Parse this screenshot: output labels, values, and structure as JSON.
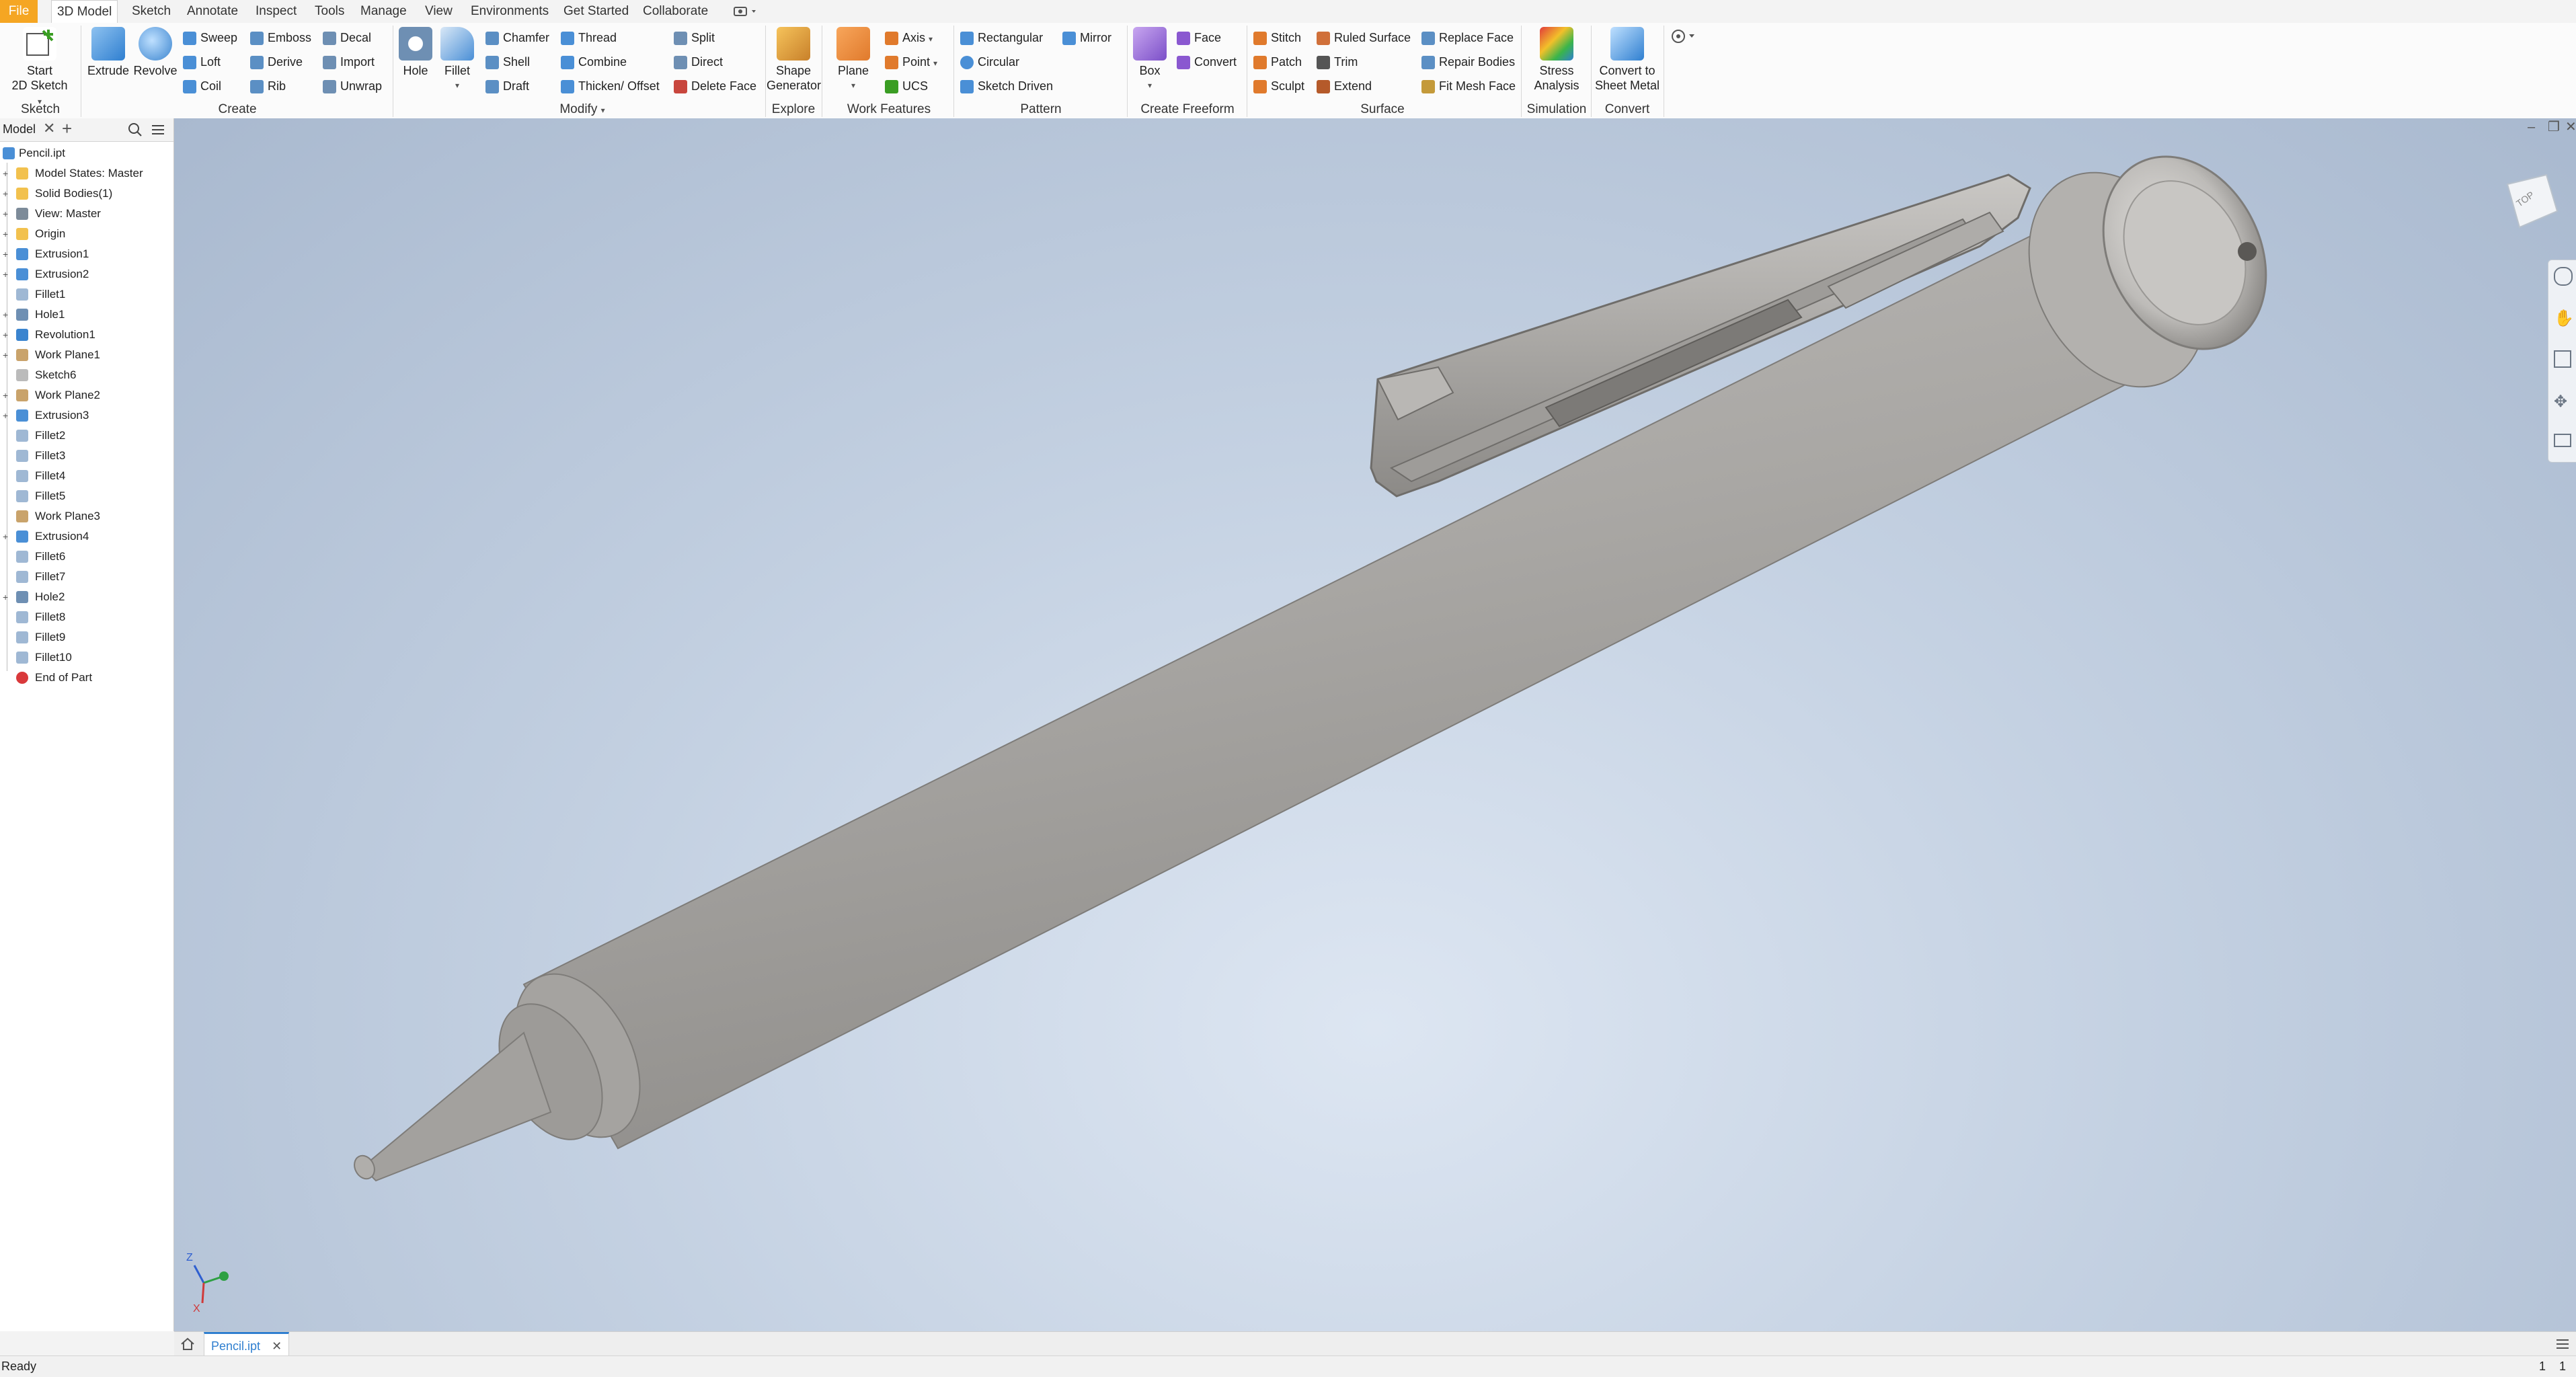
{
  "menu": {
    "tabs": [
      "File",
      "3D Model",
      "Sketch",
      "Annotate",
      "Inspect",
      "Tools",
      "Manage",
      "View",
      "Environments",
      "Get Started",
      "Collaborate"
    ],
    "active": "3D Model"
  },
  "ribbon": {
    "sketch": {
      "start_line1": "Start",
      "start_line2": "2D Sketch",
      "group": "Sketch"
    },
    "create": {
      "extrude": "Extrude",
      "revolve": "Revolve",
      "sweep": "Sweep",
      "loft": "Loft",
      "coil": "Coil",
      "emboss": "Emboss",
      "derive": "Derive",
      "rib": "Rib",
      "decal": "Decal",
      "import": "Import",
      "unwrap": "Unwrap",
      "group": "Create"
    },
    "modify": {
      "hole": "Hole",
      "fillet": "Fillet",
      "chamfer": "Chamfer",
      "shell": "Shell",
      "draft": "Draft",
      "thread": "Thread",
      "combine": "Combine",
      "thicken": "Thicken/ Offset",
      "split": "Split",
      "direct": "Direct",
      "delete_face": "Delete Face",
      "group": "Modify"
    },
    "explore": {
      "shape_line1": "Shape",
      "shape_line2": "Generator",
      "group": "Explore"
    },
    "work_features": {
      "plane": "Plane",
      "axis": "Axis",
      "point": "Point",
      "ucs": "UCS",
      "group": "Work Features"
    },
    "pattern": {
      "rectangular": "Rectangular",
      "circular": "Circular",
      "sketch_driven": "Sketch Driven",
      "mirror": "Mirror",
      "group": "Pattern"
    },
    "freeform": {
      "box": "Box",
      "face": "Face",
      "convert": "Convert",
      "group": "Create Freeform"
    },
    "surface": {
      "stitch": "Stitch",
      "patch": "Patch",
      "sculpt": "Sculpt",
      "ruled": "Ruled Surface",
      "trim": "Trim",
      "extend": "Extend",
      "replace": "Replace Face",
      "repair": "Repair Bodies",
      "fitmesh": "Fit Mesh Face",
      "group": "Surface"
    },
    "simulation": {
      "line1": "Stress",
      "line2": "Analysis",
      "group": "Simulation"
    },
    "convert": {
      "line1": "Convert to",
      "line2": "Sheet Metal",
      "group": "Convert"
    }
  },
  "browser": {
    "tab_label": "Model",
    "root": "Pencil.ipt",
    "items": [
      {
        "label": "Model States: Master",
        "icon": "folder-icon",
        "expand": true
      },
      {
        "label": "Solid Bodies(1)",
        "icon": "folder-icon",
        "expand": true
      },
      {
        "label": "View: Master",
        "icon": "view-icon",
        "expand": true
      },
      {
        "label": "Origin",
        "icon": "folder-icon",
        "expand": true
      },
      {
        "label": "Extrusion1",
        "icon": "extrude-icon",
        "expand": true
      },
      {
        "label": "Extrusion2",
        "icon": "extrude-icon",
        "expand": true
      },
      {
        "label": "Fillet1",
        "icon": "fillet-icon",
        "expand": false
      },
      {
        "label": "Hole1",
        "icon": "hole-icon",
        "expand": true
      },
      {
        "label": "Revolution1",
        "icon": "revolve-icon",
        "expand": true
      },
      {
        "label": "Work Plane1",
        "icon": "workplane-icon",
        "expand": true
      },
      {
        "label": "Sketch6",
        "icon": "sketch-icon",
        "expand": false
      },
      {
        "label": "Work Plane2",
        "icon": "workplane-icon",
        "expand": true
      },
      {
        "label": "Extrusion3",
        "icon": "extrude-icon",
        "expand": true
      },
      {
        "label": "Fillet2",
        "icon": "fillet-icon",
        "expand": false
      },
      {
        "label": "Fillet3",
        "icon": "fillet-icon",
        "expand": false
      },
      {
        "label": "Fillet4",
        "icon": "fillet-icon",
        "expand": false
      },
      {
        "label": "Fillet5",
        "icon": "fillet-icon",
        "expand": false
      },
      {
        "label": "Work Plane3",
        "icon": "workplane-icon",
        "expand": false
      },
      {
        "label": "Extrusion4",
        "icon": "extrude-icon",
        "expand": true
      },
      {
        "label": "Fillet6",
        "icon": "fillet-icon",
        "expand": false
      },
      {
        "label": "Fillet7",
        "icon": "fillet-icon",
        "expand": false
      },
      {
        "label": "Hole2",
        "icon": "hole-icon",
        "expand": true
      },
      {
        "label": "Fillet8",
        "icon": "fillet-icon",
        "expand": false
      },
      {
        "label": "Fillet9",
        "icon": "fillet-icon",
        "expand": false
      },
      {
        "label": "Fillet10",
        "icon": "fillet-icon",
        "expand": false
      },
      {
        "label": "End of Part",
        "icon": "end-of-part-icon",
        "expand": false
      }
    ]
  },
  "viewcube": {
    "face": "TOP"
  },
  "axes": {
    "z": "Z",
    "x": "X"
  },
  "doc_tab": {
    "label": "Pencil.ipt"
  },
  "status": {
    "text": "Ready",
    "right1": "1",
    "right2": "1"
  },
  "colors": {
    "accent": "#f5a623",
    "viewport": "#c4d1e2",
    "part": "#a8a6a3"
  }
}
